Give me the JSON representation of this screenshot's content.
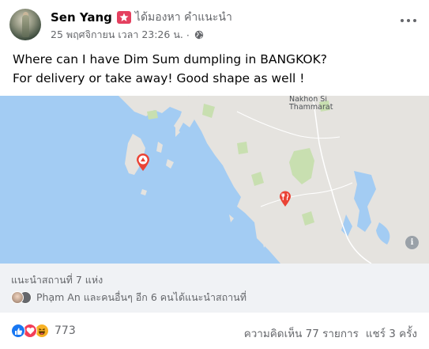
{
  "post": {
    "author": "Sen Yang",
    "action": "ได้มองหา คำแนะนำ",
    "timestamp": "25 พฤศจิกายน เวลา 23:26 น.",
    "separator": "·",
    "text_lines": [
      "Where can I have Dim Sum dumpling in BANGKOK?",
      "For delivery or take away! Good shape as well !"
    ]
  },
  "map": {
    "labels": {
      "city_line1": "Nakhon Si",
      "city_line2": "Thammarat"
    },
    "colors": {
      "water": "#a3ccf3",
      "land": "#e5e3df",
      "park": "#c8dfb0",
      "pin": "#ea4335"
    },
    "info_glyph": "i"
  },
  "places": {
    "title": "แนะนำสถานที่ 7 แห่ง",
    "recommenders_text": "Phạm An และคนอื่นๆ อีก 6 คนได้แนะนำสถานที่"
  },
  "reactions": {
    "count": "773",
    "comments": "ความคิดเห็น 77 รายการ",
    "shares": "แชร์ 3 ครั้ง",
    "icons": [
      "like-icon",
      "love-icon",
      "haha-icon"
    ]
  },
  "theme": {
    "secondary_text": "#65676b",
    "badge": "#e4405f",
    "like_blue": "#1877f2"
  }
}
